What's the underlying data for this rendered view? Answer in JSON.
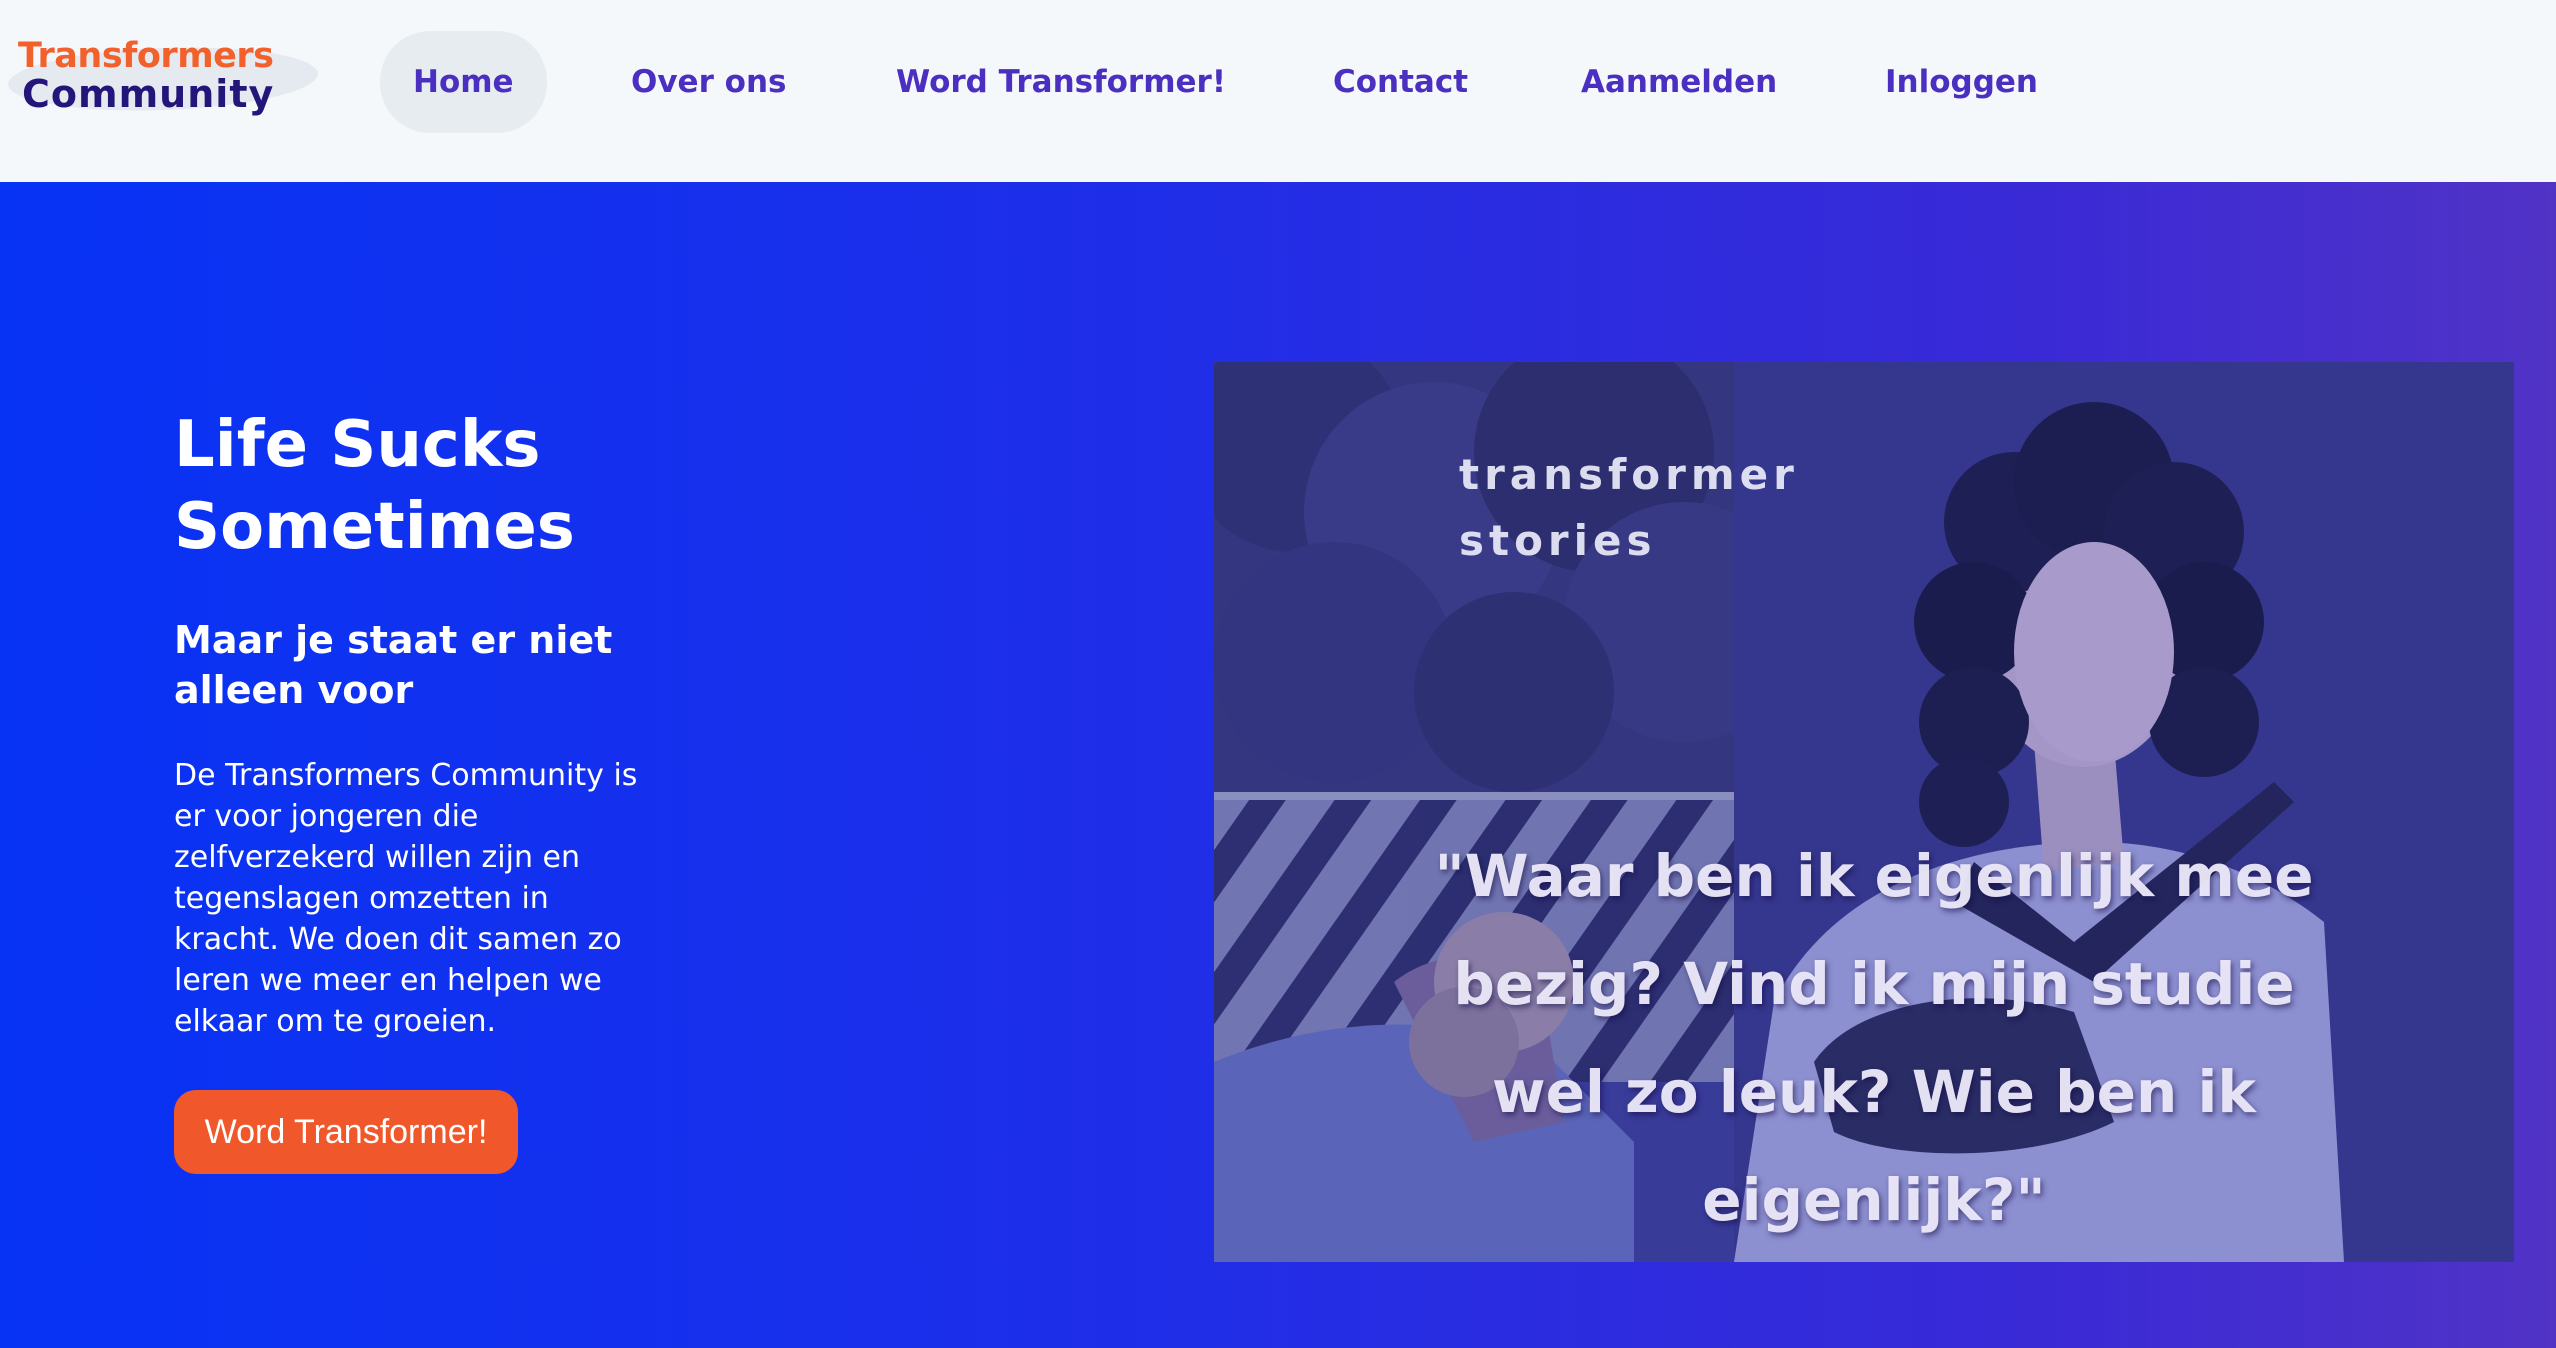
{
  "brand": {
    "line1": "Transformers",
    "line2": "Community",
    "color_top": "#f2612c",
    "color_bottom": "#23157a"
  },
  "nav": {
    "items": [
      {
        "label": "Home",
        "active": true
      },
      {
        "label": "Over ons"
      },
      {
        "label": "Word Transformer!"
      },
      {
        "label": "Contact"
      },
      {
        "label": "Aanmelden"
      },
      {
        "label": "Inloggen"
      }
    ],
    "color": "#4a2fc0"
  },
  "hero": {
    "title": "Life Sucks Sometimes",
    "subtitle": "Maar je staat er niet alleen voor",
    "body": "De Transformers Community is er voor jongeren die zelfverzekerd willen zijn en tegenslagen omzetten in kracht. We doen dit samen zo leren we meer en helpen we elkaar om te groeien.",
    "cta_label": "Word Transformer!",
    "cta_color": "#f0582b",
    "background_start": "#0733f5",
    "background_end": "#5133c6"
  },
  "story": {
    "label": "transformer\nstories",
    "quote": "\"Waar ben ik eigenlijk mee bezig? Vind ik mijn studie wel zo leuk? Wie ben ik eigenlijk?\"",
    "overlay_color": "#3f3f9c"
  }
}
